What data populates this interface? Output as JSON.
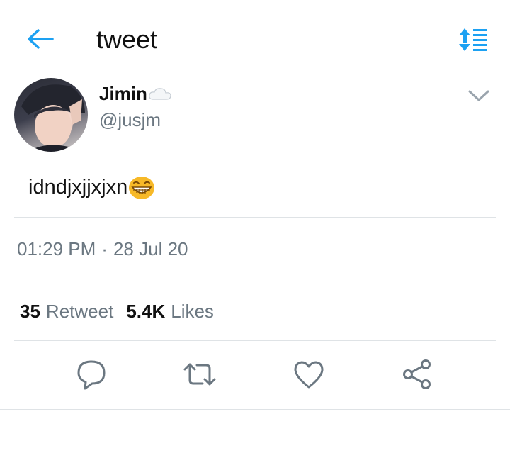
{
  "header": {
    "title": "tweet",
    "back_icon": "arrow-left-icon",
    "sort_icon": "sort-list-icon",
    "accent_color": "#1da1f2"
  },
  "tweet": {
    "author_name": "Jimin",
    "author_handle": "@jusjm",
    "name_emoji": "cloud-emoji",
    "text": "idndjxjjxjxn",
    "text_emoji": "grinning-squinting-face-emoji",
    "time": "01:29 PM",
    "separator": "·",
    "date": "28 Jul 20"
  },
  "stats": {
    "retweets_count": "35",
    "retweets_label": "Retweet",
    "likes_count": "5.4K",
    "likes_label": "Likes"
  },
  "actions": {
    "reply_icon": "reply-icon",
    "retweet_icon": "retweet-icon",
    "like_icon": "heart-icon",
    "share_icon": "share-icon"
  },
  "colors": {
    "text_primary": "#111111",
    "text_secondary": "#6b7781",
    "divider": "#dfe3e6",
    "accent": "#1da1f2"
  }
}
